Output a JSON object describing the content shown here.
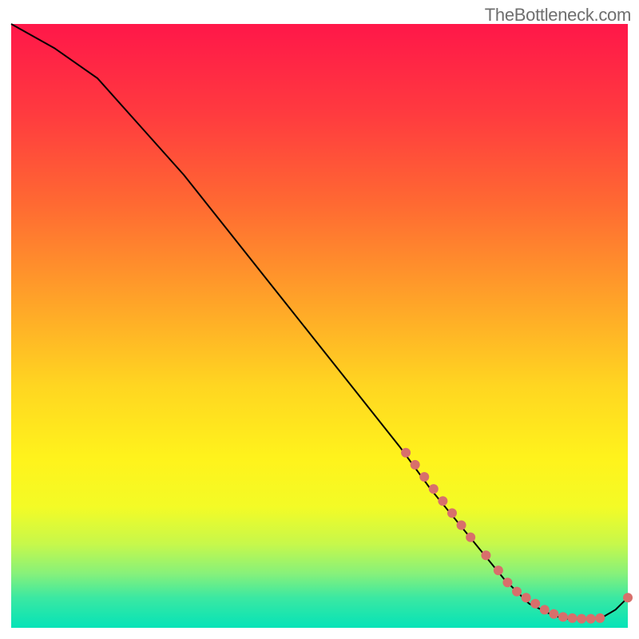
{
  "watermark": "TheBottleneck.com",
  "chart_data": {
    "type": "line",
    "title": "",
    "xlabel": "",
    "ylabel": "",
    "xlim": [
      0,
      100
    ],
    "ylim": [
      0,
      100
    ],
    "line": {
      "x": [
        0,
        7,
        14,
        21,
        28,
        35,
        42,
        49,
        56,
        63,
        68,
        72,
        76,
        80,
        82,
        84,
        86,
        88,
        90,
        92,
        94,
        96,
        98,
        100
      ],
      "y": [
        100,
        96,
        91,
        83,
        75,
        66,
        57,
        48,
        39,
        30,
        23,
        18,
        13,
        8,
        6,
        4,
        3,
        2,
        1.5,
        1.5,
        1.5,
        1.8,
        3,
        5
      ]
    },
    "markers": {
      "x": [
        64,
        65.5,
        67,
        68.5,
        70,
        71.5,
        73,
        74.5,
        77,
        79,
        80.5,
        82,
        83.5,
        85,
        86.5,
        88,
        89.5,
        91,
        92.5,
        94,
        95.5,
        100
      ],
      "y": [
        29,
        27,
        25,
        23,
        21,
        19,
        17,
        15,
        12,
        9.5,
        7.5,
        6,
        5,
        4,
        3,
        2.3,
        1.8,
        1.6,
        1.5,
        1.5,
        1.6,
        5
      ]
    },
    "gradient_stops": [
      {
        "offset": 0,
        "color": "#ff1749"
      },
      {
        "offset": 0.15,
        "color": "#ff3b3f"
      },
      {
        "offset": 0.3,
        "color": "#ff6a32"
      },
      {
        "offset": 0.45,
        "color": "#ffa029"
      },
      {
        "offset": 0.6,
        "color": "#ffd621"
      },
      {
        "offset": 0.72,
        "color": "#fff31c"
      },
      {
        "offset": 0.8,
        "color": "#f3fb26"
      },
      {
        "offset": 0.86,
        "color": "#c8f84a"
      },
      {
        "offset": 0.91,
        "color": "#87f17a"
      },
      {
        "offset": 0.95,
        "color": "#3be8a2"
      },
      {
        "offset": 1.0,
        "color": "#05e3b8"
      }
    ],
    "marker_color": "#d86f6b",
    "line_color": "#000000"
  }
}
